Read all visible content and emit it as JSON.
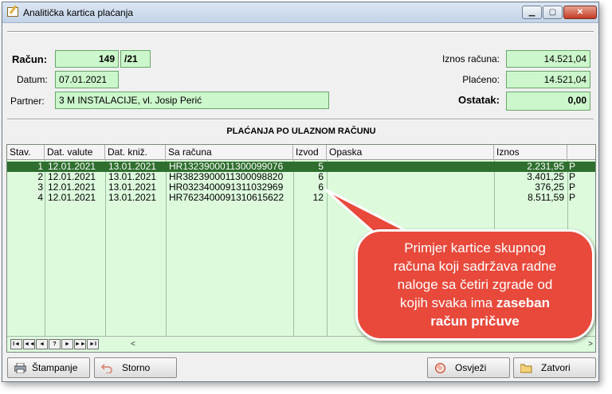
{
  "window": {
    "title": "Analitička kartica plaćanja"
  },
  "header": {
    "racun_label": "Račun:",
    "racun_number": "149",
    "racun_year": "/21",
    "datum_label": "Datum:",
    "datum_value": "07.01.2021",
    "partner_label": "Partner:",
    "partner_value": "3 M INSTALACIJE, vl. Josip Perić",
    "iznos_label": "Iznos računa:",
    "iznos_value": "14.521,04",
    "placeno_label": "Plaćeno:",
    "placeno_value": "14.521,04",
    "ostatak_label": "Ostatak:",
    "ostatak_value": "0,00"
  },
  "section_title": "PLAĆANJA PO ULAZNOM RAČUNU",
  "table": {
    "columns": [
      "Stav.",
      "Dat. valute",
      "Dat. kniž.",
      "Sa računa",
      "Izvod",
      "Opaska",
      "Iznos"
    ],
    "rows": [
      {
        "stav": "1",
        "dat_valute": "12.01.2021",
        "dat_kniz": "13.01.2021",
        "sa_racuna": "HR1323900011300099076",
        "izvod": "5",
        "opaska": "",
        "iznos": "2.231,95",
        "flag": "P"
      },
      {
        "stav": "2",
        "dat_valute": "12.01.2021",
        "dat_kniz": "13.01.2021",
        "sa_racuna": "HR3823900011300098820",
        "izvod": "6",
        "opaska": "",
        "iznos": "3.401,25",
        "flag": "P"
      },
      {
        "stav": "3",
        "dat_valute": "12.01.2021",
        "dat_kniz": "13.01.2021",
        "sa_racuna": "HR0323400091311032969",
        "izvod": "6",
        "opaska": "",
        "iznos": "376,25",
        "flag": "P"
      },
      {
        "stav": "4",
        "dat_valute": "12.01.2021",
        "dat_kniz": "13.01.2021",
        "sa_racuna": "HR7623400091310615622",
        "izvod": "12",
        "opaska": "",
        "iznos": "8.511,59",
        "flag": "P"
      }
    ]
  },
  "nav_buttons": [
    "I◄",
    "◄◄",
    "◄",
    "?",
    "►",
    "►►",
    "►I"
  ],
  "buttons": {
    "stampanje": "Štampanje",
    "storno": "Storno",
    "osvjezi": "Osvježi",
    "zatvori": "Zatvori"
  },
  "callout": {
    "line1": "Primjer kartice skupnog",
    "line2": "računa koji sadržava radne",
    "line3": "naloge sa četiri zgrade od",
    "line4_prefix": "kojih svaka ima ",
    "line4_bold": "zaseban",
    "line5_bold": "račun pričuve"
  },
  "colors": {
    "field_bg": "#ccf7cc",
    "selected_row": "#2f6e2f",
    "callout": "#e8493b"
  }
}
